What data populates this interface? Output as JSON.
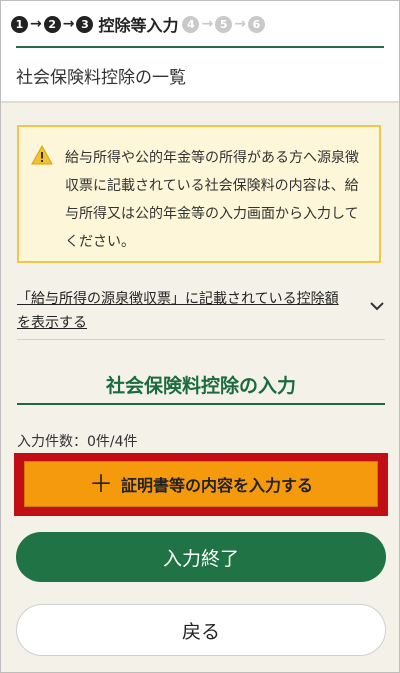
{
  "steps": {
    "items": [
      {
        "num": "1",
        "active": true
      },
      {
        "num": "2",
        "active": true
      },
      {
        "num": "3",
        "active": true,
        "label": "控除等入力"
      },
      {
        "num": "4",
        "active": false
      },
      {
        "num": "5",
        "active": false
      },
      {
        "num": "6",
        "active": false
      }
    ],
    "arrow": "→",
    "label": "控除等入力"
  },
  "page": {
    "title": "社会保険料控除の一覧"
  },
  "notice": {
    "icon": "warning-icon",
    "text": "給与所得や公的年金等の所得がある方へ源泉徴収票に記載されている社会保険料の内容は、給与所得又は公的年金等の入力画面から入力してください。"
  },
  "disclosure": {
    "text": "「給与所得の源泉徴収票」に記載されている控除額を表示する",
    "icon": "chevron-down-icon"
  },
  "section": {
    "title": "社会保険料控除の入力",
    "count": "入力件数：0件/4件"
  },
  "buttons": {
    "enter_plus": "＋",
    "enter": "証明書等の内容を入力する",
    "finish": "入力終了",
    "back": "戻る"
  },
  "colors": {
    "green": "#1f7344",
    "orange": "#f59a0c",
    "highlight_red": "#c00e14",
    "notice_border": "#f1c64b",
    "background": "#f4f1e8"
  }
}
